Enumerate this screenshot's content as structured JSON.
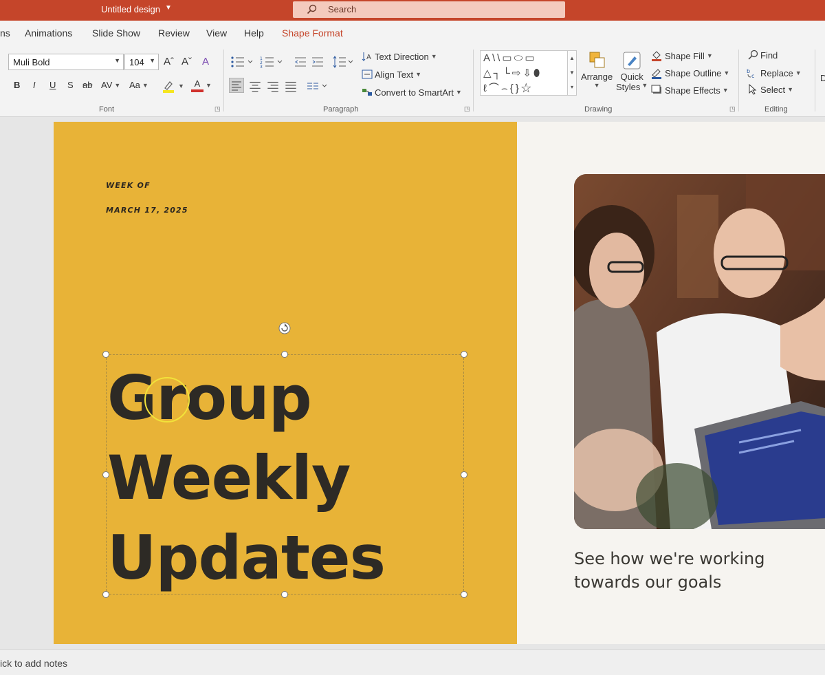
{
  "title_bar": {
    "doc_title": "Untitled design",
    "search_placeholder": "Search"
  },
  "tabs": [
    {
      "label": "ns"
    },
    {
      "label": "Animations"
    },
    {
      "label": "Slide Show"
    },
    {
      "label": "Review"
    },
    {
      "label": "View"
    },
    {
      "label": "Help"
    },
    {
      "label": "Shape Format",
      "active": true
    }
  ],
  "ribbon": {
    "font": {
      "family": "Muli Bold",
      "size": "104",
      "grow": "Aˆ",
      "shrink": "Aˇ",
      "clear": "A",
      "bold": "B",
      "italic": "I",
      "underline": "U",
      "shadow": "S",
      "strike": "ab",
      "spacing": "AV",
      "case": "Aa",
      "font_color": "A",
      "label": "Font"
    },
    "paragraph": {
      "text_direction": "Text Direction",
      "align_text": "Align Text",
      "convert_smartart": "Convert to SmartArt",
      "label": "Paragraph"
    },
    "drawing": {
      "shapes_row1": "A\\\\▭⬭▭",
      "shapes_row2": "△┐└⇨⇩⬮",
      "shapes_row3": "ℓ⌒⌢{}☆",
      "arrange": "Arrange",
      "quick": "Quick",
      "styles": "Styles",
      "shape_fill": "Shape Fill",
      "shape_outline": "Shape Outline",
      "shape_effects": "Shape Effects",
      "label": "Drawing"
    },
    "editing": {
      "find": "Find",
      "replace": "Replace",
      "select": "Select",
      "label": "Editing"
    },
    "colors": {
      "highlight": "#f5e51f",
      "font_color": "#d0312d",
      "fill": "#c5452a"
    }
  },
  "slide": {
    "week_label": "WEEK OF",
    "week_date": "MARCH 17, 2025",
    "headline": [
      "Group",
      "Weekly",
      "Updates"
    ],
    "caption_line1": "See how we're working",
    "caption_line2": "towards our goals",
    "bg_left": "#e8b337",
    "bg_right": "#f6f4f0",
    "text_color": "#2d2a25"
  },
  "notes": {
    "placeholder": "ick to add notes"
  }
}
